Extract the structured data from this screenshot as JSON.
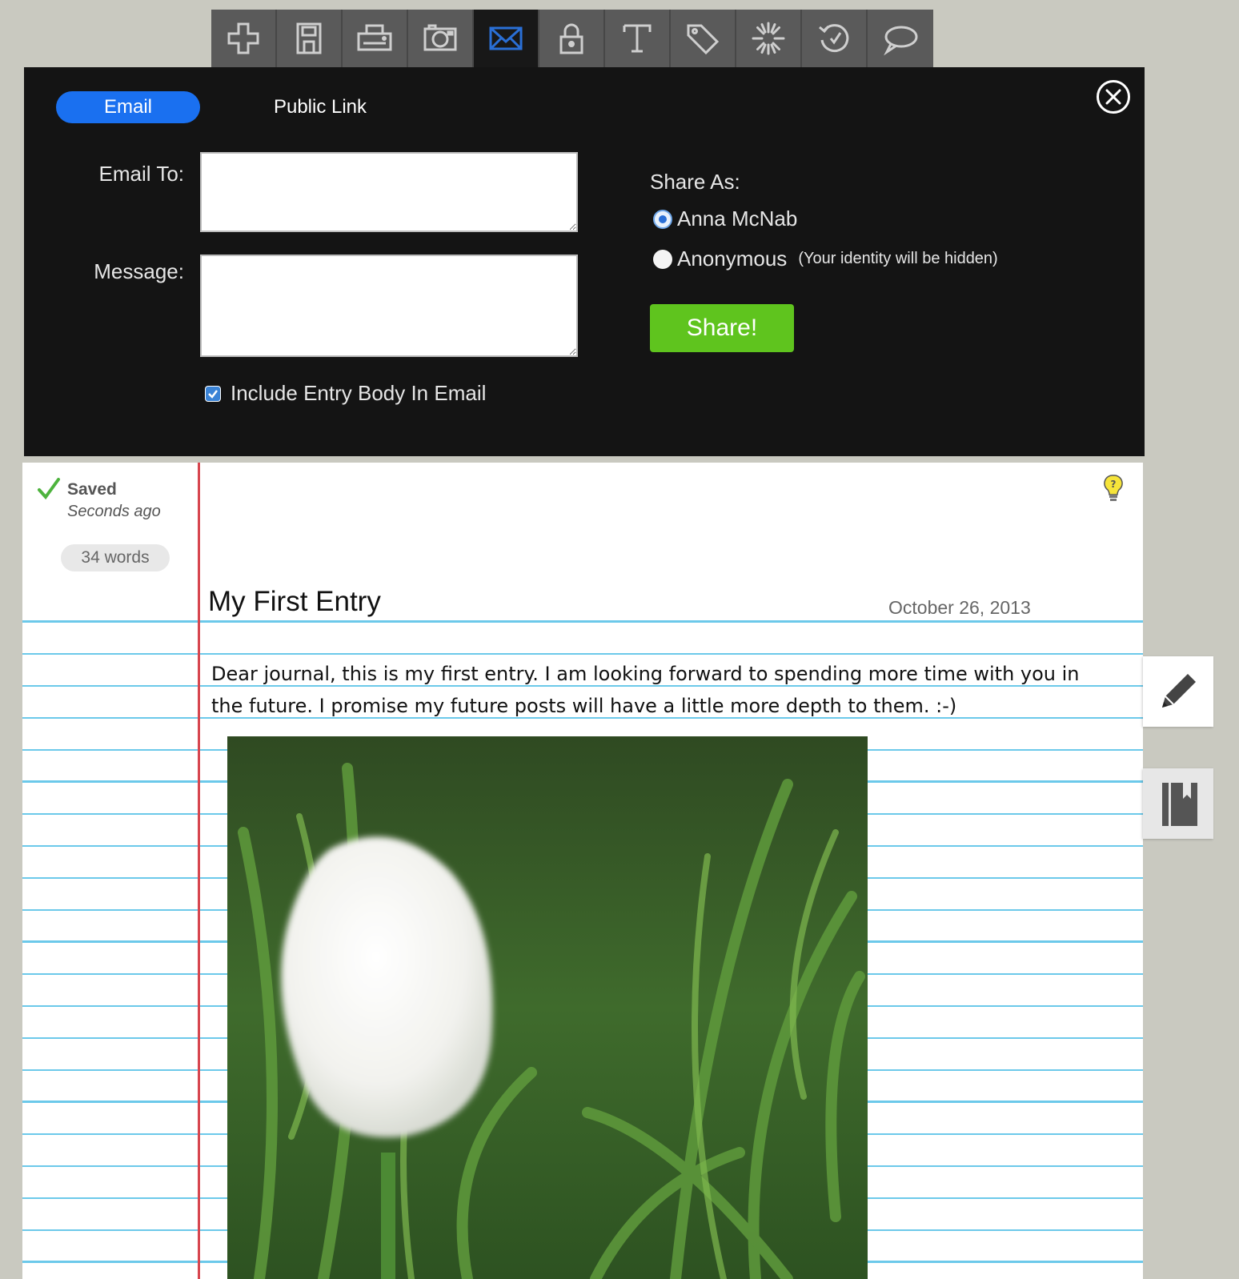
{
  "toolbar": {
    "items": [
      {
        "icon": "plus-icon",
        "active": false
      },
      {
        "icon": "save-icon",
        "active": false
      },
      {
        "icon": "printer-icon",
        "active": false
      },
      {
        "icon": "camera-icon",
        "active": false
      },
      {
        "icon": "email-icon",
        "active": true
      },
      {
        "icon": "lock-icon",
        "active": false
      },
      {
        "icon": "text-icon",
        "active": false
      },
      {
        "icon": "tag-icon",
        "active": false
      },
      {
        "icon": "spinner-icon",
        "active": false
      },
      {
        "icon": "history-icon",
        "active": false
      },
      {
        "icon": "comment-icon",
        "active": false
      }
    ],
    "active_color": "#2a6fd6"
  },
  "share": {
    "tabs": {
      "email": "Email",
      "public_link": "Public Link"
    },
    "email_to_label": "Email To:",
    "email_to_value": "",
    "message_label": "Message:",
    "message_value": "",
    "include_body_label": "Include Entry Body In Email",
    "include_body_checked": true,
    "share_as_label": "Share As:",
    "options": [
      {
        "label": "Anna McNab",
        "selected": true
      },
      {
        "label": "Anonymous",
        "note": "(Your identity will be hidden)",
        "selected": false
      }
    ],
    "share_button": "Share!",
    "colors": {
      "tab_active": "#1a70f0",
      "share_button": "#5fc41e",
      "panel_bg": "#141414"
    }
  },
  "status": {
    "saved": "Saved",
    "saved_time": "Seconds ago",
    "word_count": "34 words"
  },
  "entry": {
    "title": "My First Entry",
    "date": "October 26, 2013",
    "body": "Dear journal, this is my first entry. I am looking forward to spending more time with you in the future. I promise my future posts will have a little more depth to them. :-)",
    "image": "white tulip photo"
  },
  "side_buttons": [
    "pencil-icon",
    "notebook-icon"
  ]
}
